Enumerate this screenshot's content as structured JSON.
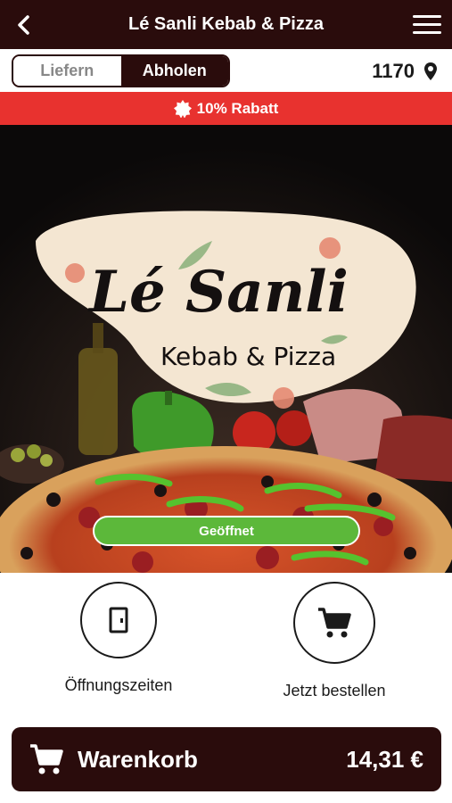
{
  "header": {
    "title": "Lé Sanli Kebab & Pizza",
    "back_icon": "chevron-left-icon",
    "menu_icon": "hamburger-menu-icon"
  },
  "mode_toggle": {
    "options": [
      "Liefern",
      "Abholen"
    ],
    "selected": "Abholen"
  },
  "location": {
    "postcode": "1170",
    "icon": "map-pin-icon"
  },
  "promo": {
    "text": "10% Rabatt",
    "icon": "badge-icon",
    "color": "#e8322f"
  },
  "hero": {
    "logo_line1": "Lé Sanli",
    "logo_line2": "Kebab & Pizza",
    "status_label": "Geöffnet",
    "status_color": "#5cb83a"
  },
  "actions": [
    {
      "label": "Öffnungszeiten",
      "icon": "door-icon"
    },
    {
      "label": "Jetzt bestellen",
      "icon": "cart-icon"
    }
  ],
  "cart": {
    "label": "Warenkorb",
    "total": "14,31 €",
    "icon": "cart-icon"
  },
  "colors": {
    "brand_dark": "#2a0c0c",
    "accent_red": "#e8322f",
    "open_green": "#5cb83a",
    "logo_cream": "#f4e6d2"
  }
}
